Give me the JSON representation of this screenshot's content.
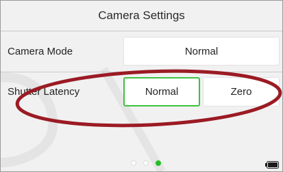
{
  "screen": {
    "title": "Camera Settings"
  },
  "settings": [
    {
      "label": "Camera Mode",
      "options": [
        {
          "label": "Normal",
          "selected": true
        }
      ]
    },
    {
      "label": "Shutter Latency",
      "options": [
        {
          "label": "Normal",
          "selected": true
        },
        {
          "label": "Zero",
          "selected": false
        }
      ]
    }
  ],
  "pagination": {
    "pages": 3,
    "current_page": 3,
    "active_color": "#21c021"
  },
  "status": {
    "battery_icon": "battery-icon"
  },
  "colors": {
    "selection_border": "#3cc23c",
    "annotation_ellipse": "#9b1b24",
    "background": "#f1f1f1"
  }
}
